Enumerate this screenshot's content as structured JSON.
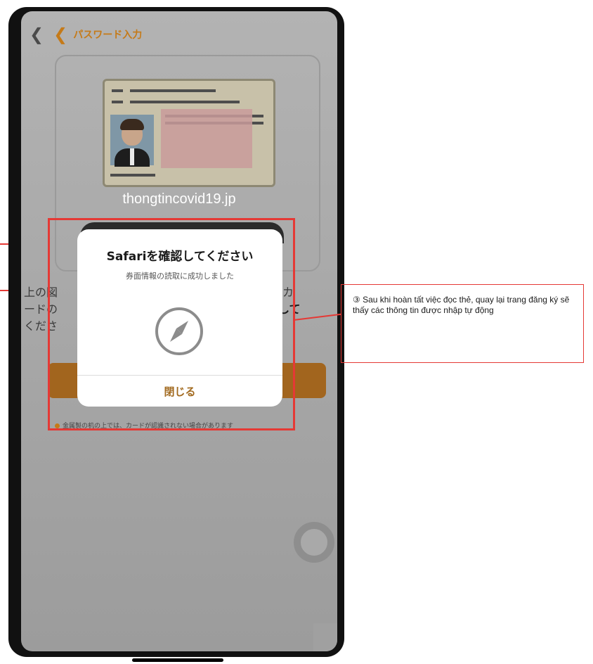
{
  "nav": {
    "title": "パスワード入力"
  },
  "card": {
    "domain": "thongtincovid19.jp"
  },
  "description": {
    "line1": "上の図",
    "line2": "ードの",
    "line3": "くださ",
    "right1": "ソーカ",
    "right2": "押して"
  },
  "note": "金属製の机の上では、カードが認識されない場合があります",
  "dialog": {
    "title": "Safariを確認してください",
    "subtitle": "券面情報の読取に成功しました",
    "close_label": "閉じる",
    "icon": "compass-icon"
  },
  "callout": {
    "text": "③ Sau khi hoàn tất việc đọc thẻ, quay lại trang đăng ký sẽ thấy các thông tin được nhập tự động"
  },
  "colors": {
    "accent": "#c57a18",
    "highlight": "#e53935"
  }
}
